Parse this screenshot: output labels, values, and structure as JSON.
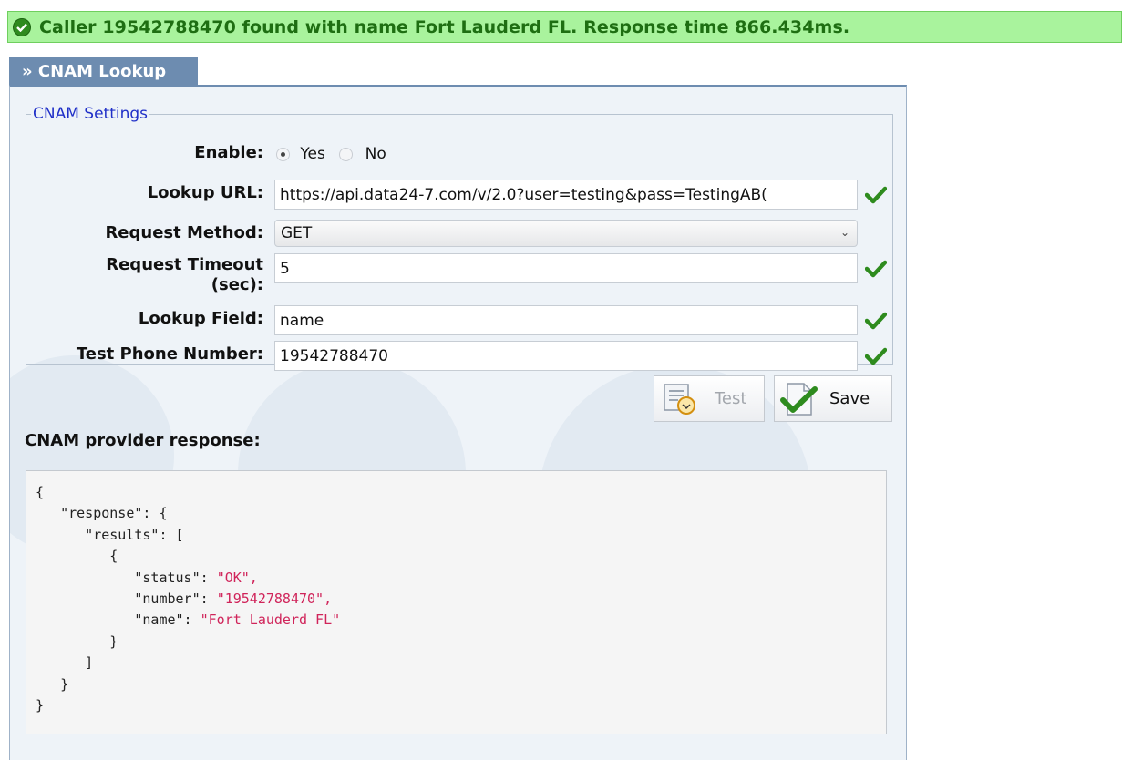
{
  "status": {
    "message": "Caller 19542788470 found with name Fort Lauderd FL. Response time 866.434ms.",
    "icon": "check-circle-icon",
    "color": "#2f8a1f"
  },
  "tab": {
    "label": "» CNAM Lookup"
  },
  "settings": {
    "legend": "CNAM Settings",
    "enable": {
      "label": "Enable:",
      "options": [
        "Yes",
        "No"
      ],
      "selected": "Yes"
    },
    "lookup_url": {
      "label": "Lookup URL:",
      "value": "https://api.data24-7.com/v/2.0?user=testing&pass=TestingAB("
    },
    "request_method": {
      "label": "Request Method:",
      "value": "GET"
    },
    "request_timeout": {
      "label_line1": "Request Timeout",
      "label_line2": "(sec):",
      "value": "5"
    },
    "lookup_field": {
      "label": "Lookup Field:",
      "value": "name"
    },
    "test_phone": {
      "label": "Test Phone Number:",
      "value": "19542788470"
    }
  },
  "buttons": {
    "test": "Test",
    "save": "Save"
  },
  "response": {
    "title": "CNAM provider response:",
    "lines": [
      "{",
      "   \"response\": {",
      "      \"results\": [",
      "         {",
      "            \"status\": ",
      "            \"number\": ",
      "            \"name\": ",
      "         }",
      "      ]",
      "   }",
      "}"
    ],
    "values": {
      "status": "\"OK\",",
      "number": "\"19542788470\",",
      "name": "\"Fort Lauderd FL\""
    }
  }
}
